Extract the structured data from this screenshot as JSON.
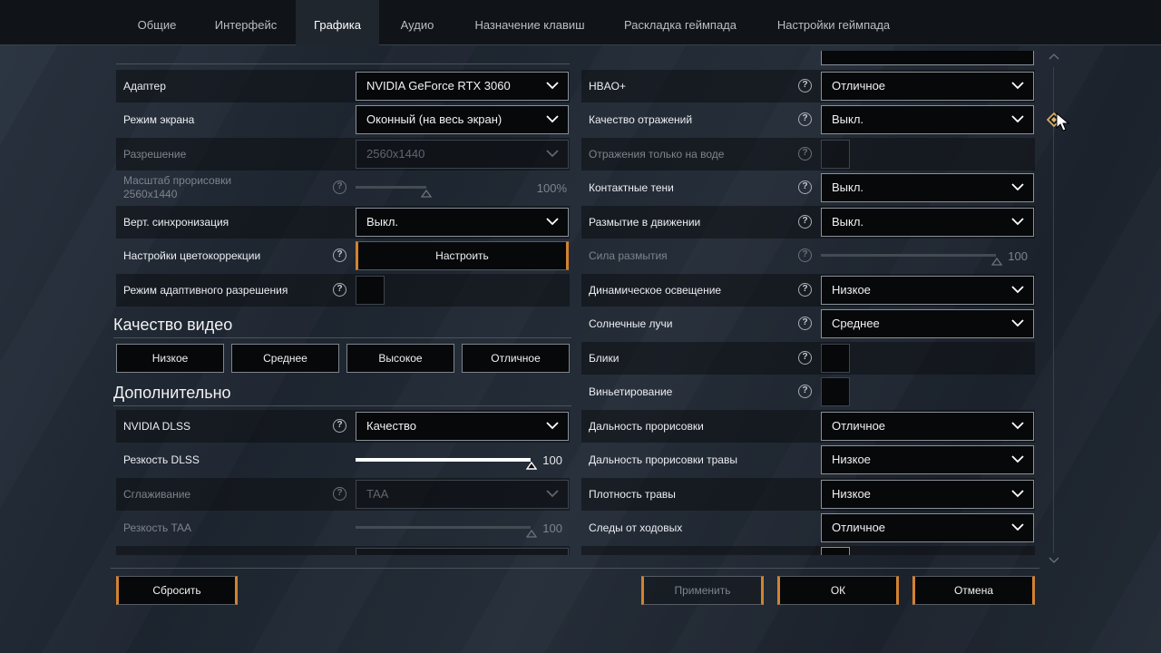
{
  "tabs": [
    "Общие",
    "Интерфейс",
    "Графика",
    "Аудио",
    "Назначение клавиш",
    "Раскладка геймпада",
    "Настройки геймпада"
  ],
  "active_tab": "Графика",
  "left": {
    "adapter": {
      "label": "Адаптер",
      "value": "NVIDIA GeForce RTX 3060"
    },
    "screen_mode": {
      "label": "Режим экрана",
      "value": "Оконный (на весь экран)"
    },
    "resolution": {
      "label": "Разрешение",
      "value": "2560x1440"
    },
    "render_scale": {
      "label_line1": "Масштаб прорисовки",
      "label_line2": "2560x1440",
      "value": "100%"
    },
    "vsync": {
      "label": "Верт. синхронизация",
      "value": "Выкл."
    },
    "color_correction": {
      "label": "Настройки цветокоррекции",
      "button": "Настроить"
    },
    "adaptive_res": {
      "label": "Режим адаптивного разрешения"
    },
    "video_quality": {
      "title": "Качество видео",
      "presets": [
        "Низкое",
        "Среднее",
        "Высокое",
        "Отличное"
      ]
    },
    "advanced": {
      "title": "Дополнительно"
    },
    "dlss": {
      "label": "NVIDIA DLSS",
      "value": "Качество"
    },
    "dlss_sharpness": {
      "label": "Резкость DLSS",
      "value": "100"
    },
    "antialiasing": {
      "label": "Сглаживание",
      "value": "TAA"
    },
    "taa_sharpness": {
      "label": "Резкость TAA",
      "value": "100"
    }
  },
  "right": {
    "hbao": {
      "label": "HBAO+",
      "value": "Отличное"
    },
    "reflections": {
      "label": "Качество отражений",
      "value": "Выкл."
    },
    "water_reflections": {
      "label": "Отражения только на воде"
    },
    "contact_shadows": {
      "label": "Контактные тени",
      "value": "Выкл."
    },
    "motion_blur": {
      "label": "Размытие в движении",
      "value": "Выкл."
    },
    "blur_strength": {
      "label": "Сила размытия",
      "value": "100"
    },
    "dynamic_lighting": {
      "label": "Динамическое освещение",
      "value": "Низкое"
    },
    "sun_rays": {
      "label": "Солнечные лучи",
      "value": "Среднее"
    },
    "lens_flares": {
      "label": "Блики"
    },
    "vignette": {
      "label": "Виньетирование"
    },
    "draw_distance": {
      "label": "Дальность прорисовки",
      "value": "Отличное"
    },
    "grass_distance": {
      "label": "Дальность прорисовки травы",
      "value": "Низкое"
    },
    "grass_density": {
      "label": "Плотность травы",
      "value": "Низкое"
    },
    "tracks": {
      "label": "Следы от ходовых",
      "value": "Отличное"
    }
  },
  "footer": {
    "reset": "Сбросить",
    "apply": "Применить",
    "ok": "ОК",
    "cancel": "Отмена"
  },
  "help_symbol": "?",
  "colors": {
    "accent": "#d3822f",
    "panel": "#06080a",
    "active_tab": "#1f262e"
  }
}
